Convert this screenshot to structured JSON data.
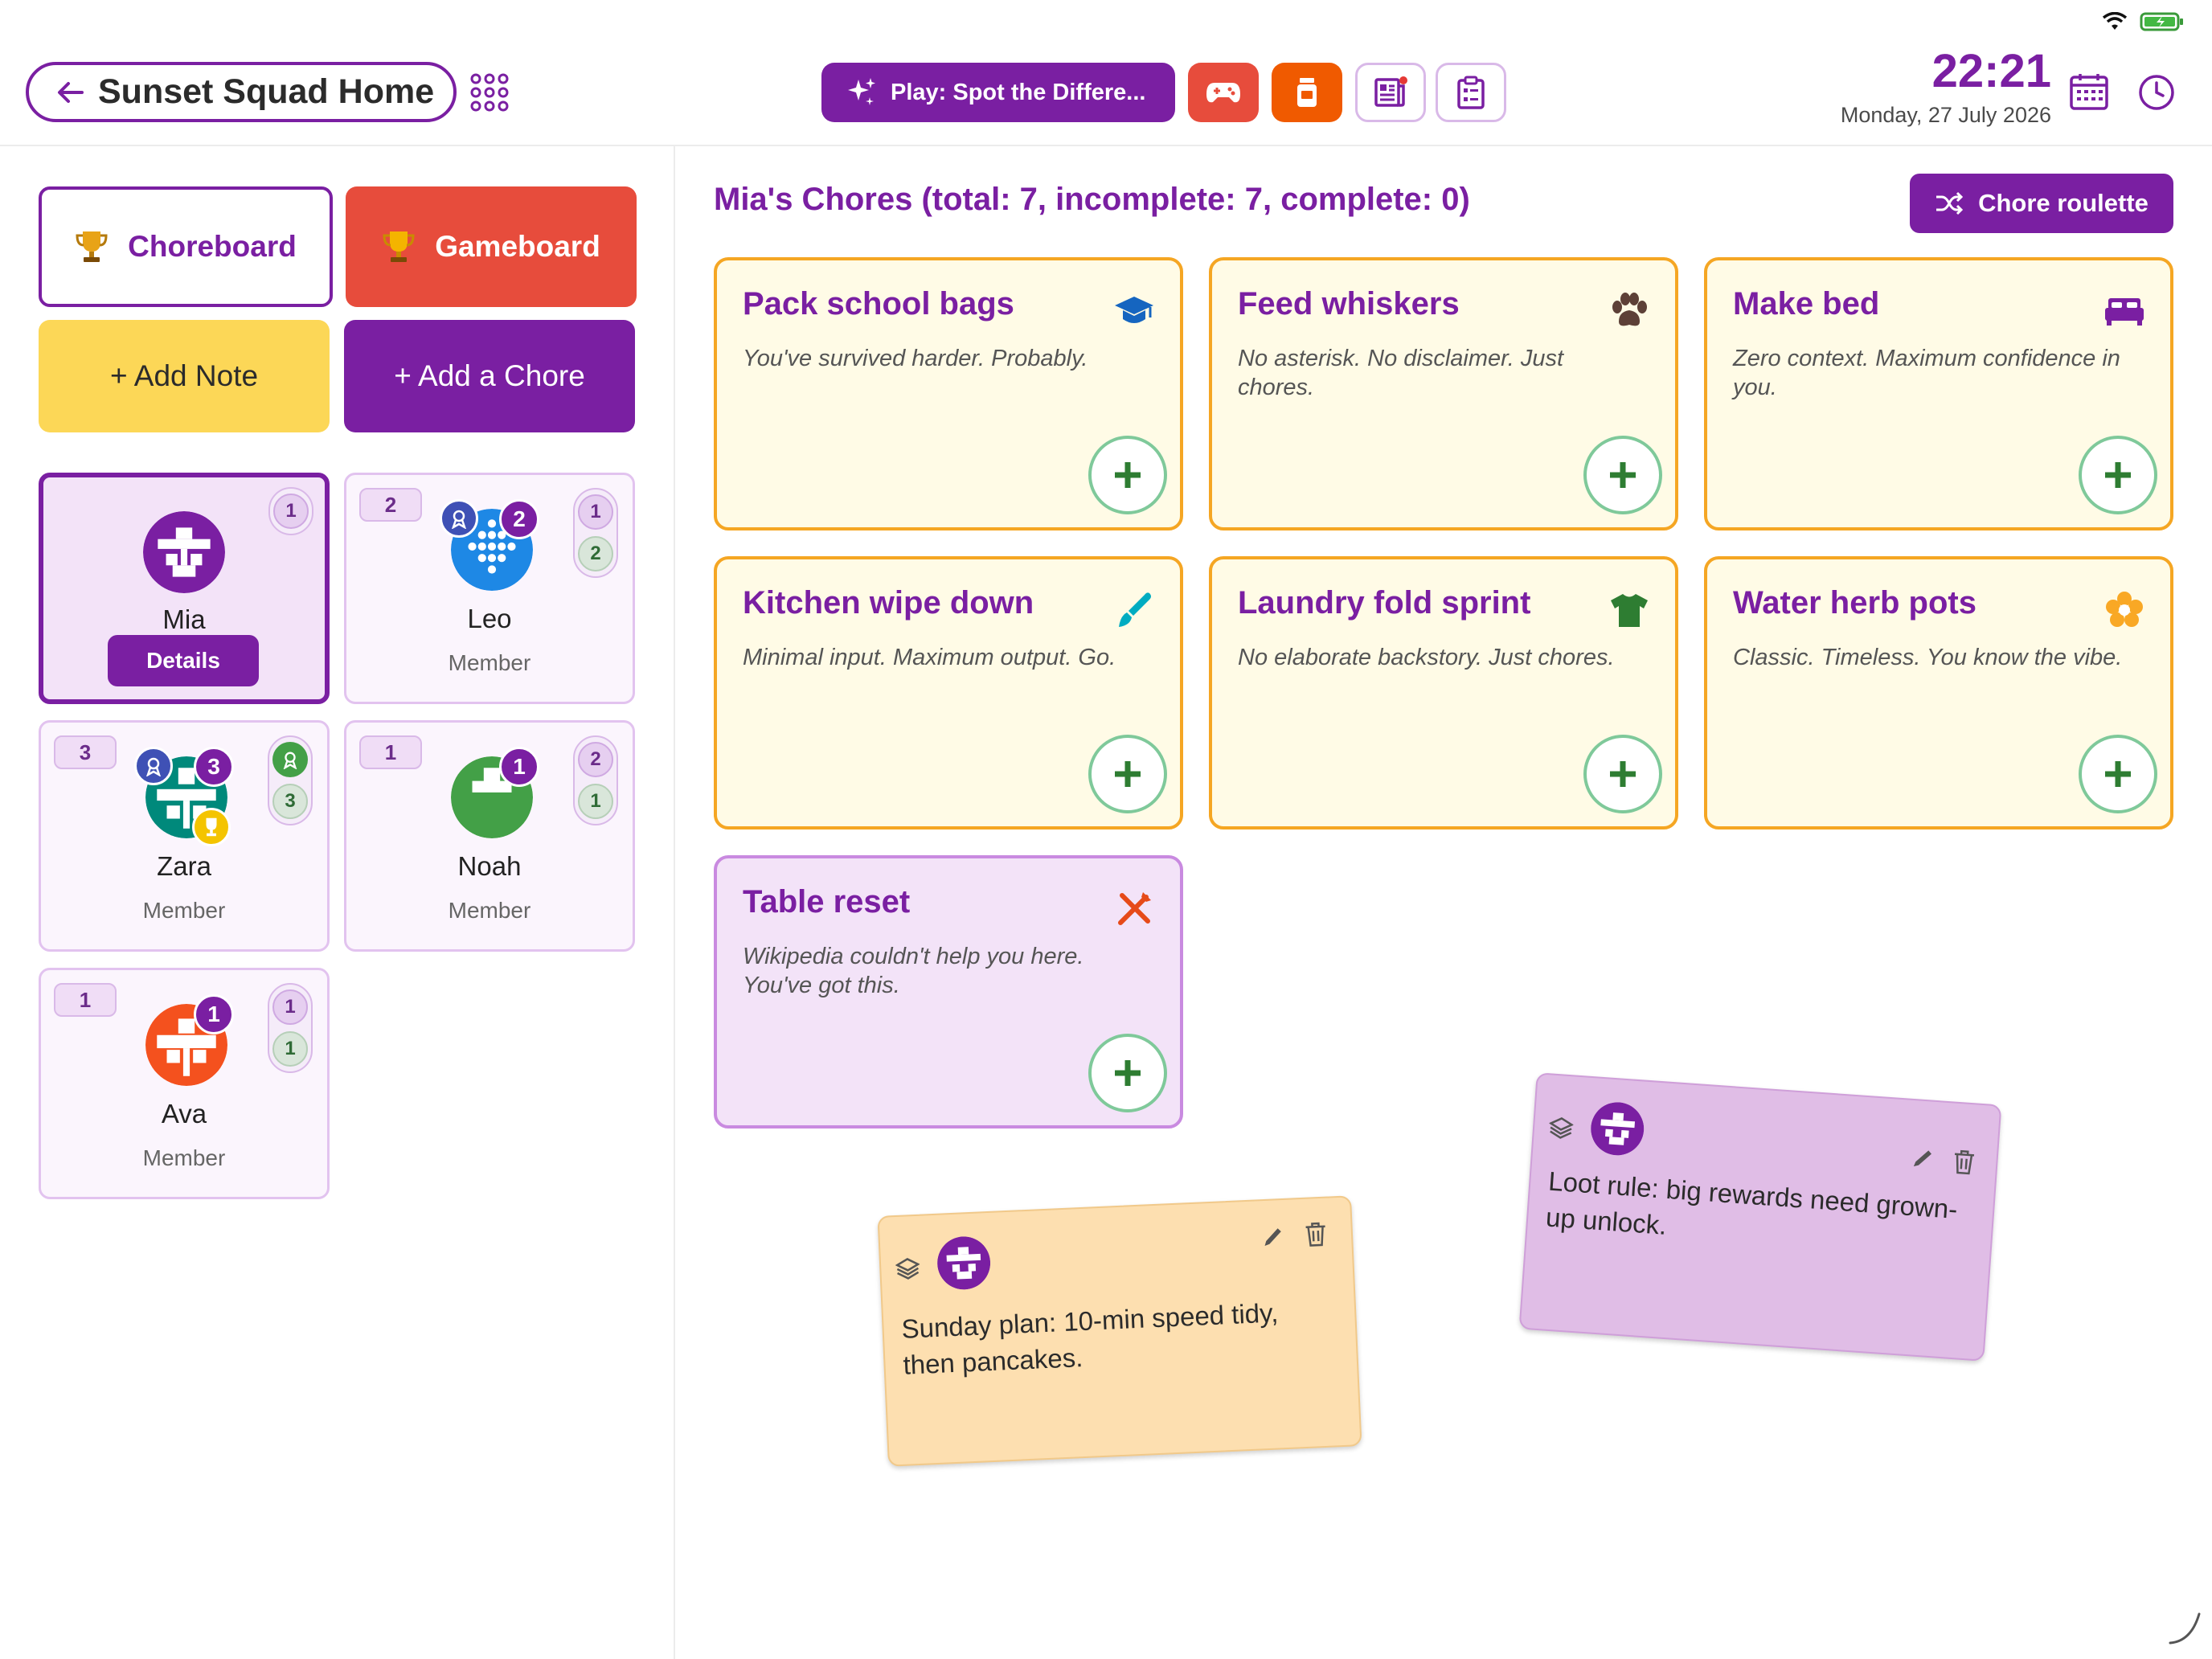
{
  "header": {
    "back_label": "Sunset Squad Home",
    "play_label": "Play: Spot the Differe...",
    "time": "22:21",
    "date": "Monday, 27 July 2026"
  },
  "left": {
    "choreboard_label": "Choreboard",
    "gameboard_label": "Gameboard",
    "add_note_label": "+ Add Note",
    "add_chore_label": "+ Add a Chore"
  },
  "members": [
    {
      "name": "Mia",
      "action": "Details",
      "level": "",
      "pill": [
        "1"
      ],
      "badge": "",
      "color": "#7a1fa2"
    },
    {
      "name": "Leo",
      "role": "Member",
      "level": "2",
      "pill": [
        "1",
        "2"
      ],
      "badge": "2",
      "color": "#1e88e5"
    },
    {
      "name": "Zara",
      "role": "Member",
      "level": "3",
      "pill": [
        "3"
      ],
      "badge": "3",
      "color": "#00897b"
    },
    {
      "name": "Noah",
      "role": "Member",
      "level": "1",
      "pill": [
        "2",
        "1"
      ],
      "badge": "1",
      "color": "#43a047"
    },
    {
      "name": "Ava",
      "role": "Member",
      "level": "1",
      "pill": [
        "1",
        "1"
      ],
      "badge": "1",
      "color": "#f4511e"
    }
  ],
  "main": {
    "title": "Mia's Chores (total: 7, incomplete: 7, complete: 0)",
    "roulette_label": "Chore roulette"
  },
  "chores": [
    {
      "title": "Pack school bags",
      "desc": "You've survived harder. Probably.",
      "icon": "graduation-cap-icon"
    },
    {
      "title": "Feed whiskers",
      "desc": "No asterisk. No disclaimer. Just chores.",
      "icon": "paw-icon"
    },
    {
      "title": "Make bed",
      "desc": "Zero context. Maximum confidence in you.",
      "icon": "bed-icon"
    },
    {
      "title": "Kitchen wipe down",
      "desc": "Minimal input. Maximum output. Go.",
      "icon": "brush-icon"
    },
    {
      "title": "Laundry fold sprint",
      "desc": "No elaborate backstory. Just chores.",
      "icon": "shirt-icon"
    },
    {
      "title": "Water herb pots",
      "desc": "Classic. Timeless. You know the vibe.",
      "icon": "flower-icon"
    },
    {
      "title": "Table reset",
      "desc": "Wikipedia couldn't help you here. You've got this.",
      "icon": "fork-knife-icon"
    }
  ],
  "notes": [
    {
      "text": "Sunday plan: 10-min speed tidy, then pancakes.",
      "color": "#fddfb0"
    },
    {
      "text": "Loot rule: big rewards need grown-up unlock.",
      "color": "#e0bde6"
    }
  ],
  "colors": {
    "accent": "#7a1fa2",
    "game_red": "#e74c3c",
    "orange": "#f05a00",
    "note_yellow": "#fcd757"
  }
}
